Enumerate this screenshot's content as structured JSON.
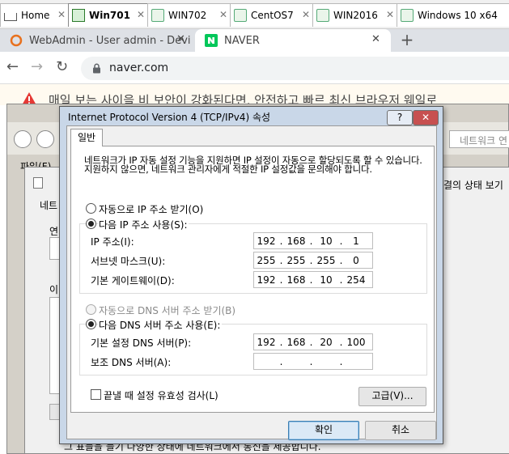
{
  "vm_tabs": [
    {
      "label": "Home",
      "icon": "home-icon"
    },
    {
      "label": "Win701",
      "icon": "vm-icon",
      "active": true
    },
    {
      "label": "WIN702",
      "icon": "vm-icon"
    },
    {
      "label": "CentOS7",
      "icon": "vm-icon"
    },
    {
      "label": "WIN2016",
      "icon": "vm-icon"
    },
    {
      "label": "Windows 10 x64",
      "icon": "vm-icon"
    }
  ],
  "browser": {
    "tabs": [
      {
        "label": "WebAdmin - User admin - Devi",
        "icon": "webadmin-icon"
      },
      {
        "label": "NAVER",
        "icon": "naver-icon",
        "active": true
      }
    ],
    "new_tab": "+",
    "url": "naver.com"
  },
  "naver_warning": {
    "text": "매일 보는 사이을 비 보안이 강화된다면, 안전하고 빠르 최신 브라우저 웨일로"
  },
  "background": {
    "menu_file": "파일(F)",
    "search_placeholder": "네트워크 연",
    "tab_partial": "네트",
    "status_partial": "결의 상태 보기",
    "label_partial1": "연",
    "label_partial2": "이",
    "bottom_partial": "그 표들을 들기 다양한 상태에 네트워크에서 통신을 제공합니다."
  },
  "dialog": {
    "title": "Internet Protocol Version 4 (TCP/IPv4) 속성",
    "help_btn": "?",
    "close_btn": "✕",
    "tab_general": "일반",
    "description": "네트워크가 IP 자동 설정 기능을 지원하면 IP 설정이 자동으로 할당되도록 할 수 있습니다. 지원하지 않으면, 네트워크 관리자에게 적절한 IP 설정값을 문의해야 합니다.",
    "auto_ip": "자동으로 IP 주소 받기(O)",
    "manual_ip": "다음 IP 주소 사용(S):",
    "ip_label": "IP 주소(I):",
    "ip_value": [
      "192",
      "168",
      "10",
      "1"
    ],
    "subnet_label": "서브넷 마스크(U):",
    "subnet_value": [
      "255",
      "255",
      "255",
      "0"
    ],
    "gateway_label": "기본 게이트웨이(D):",
    "gateway_value": [
      "192",
      "168",
      "10",
      "254"
    ],
    "auto_dns": "자동으로 DNS 서버 주소 받기(B)",
    "manual_dns": "다음 DNS 서버 주소 사용(E):",
    "pref_dns_label": "기본 설정 DNS 서버(P):",
    "pref_dns_value": [
      "192",
      "168",
      "20",
      "100"
    ],
    "alt_dns_label": "보조 DNS 서버(A):",
    "alt_dns_value": [
      "",
      "",
      "",
      ""
    ],
    "validate_label": "끝낼 때 설정 유효성 검사(L)",
    "advanced_btn": "고급(V)...",
    "ok_btn": "확인",
    "cancel_btn": "취소"
  }
}
